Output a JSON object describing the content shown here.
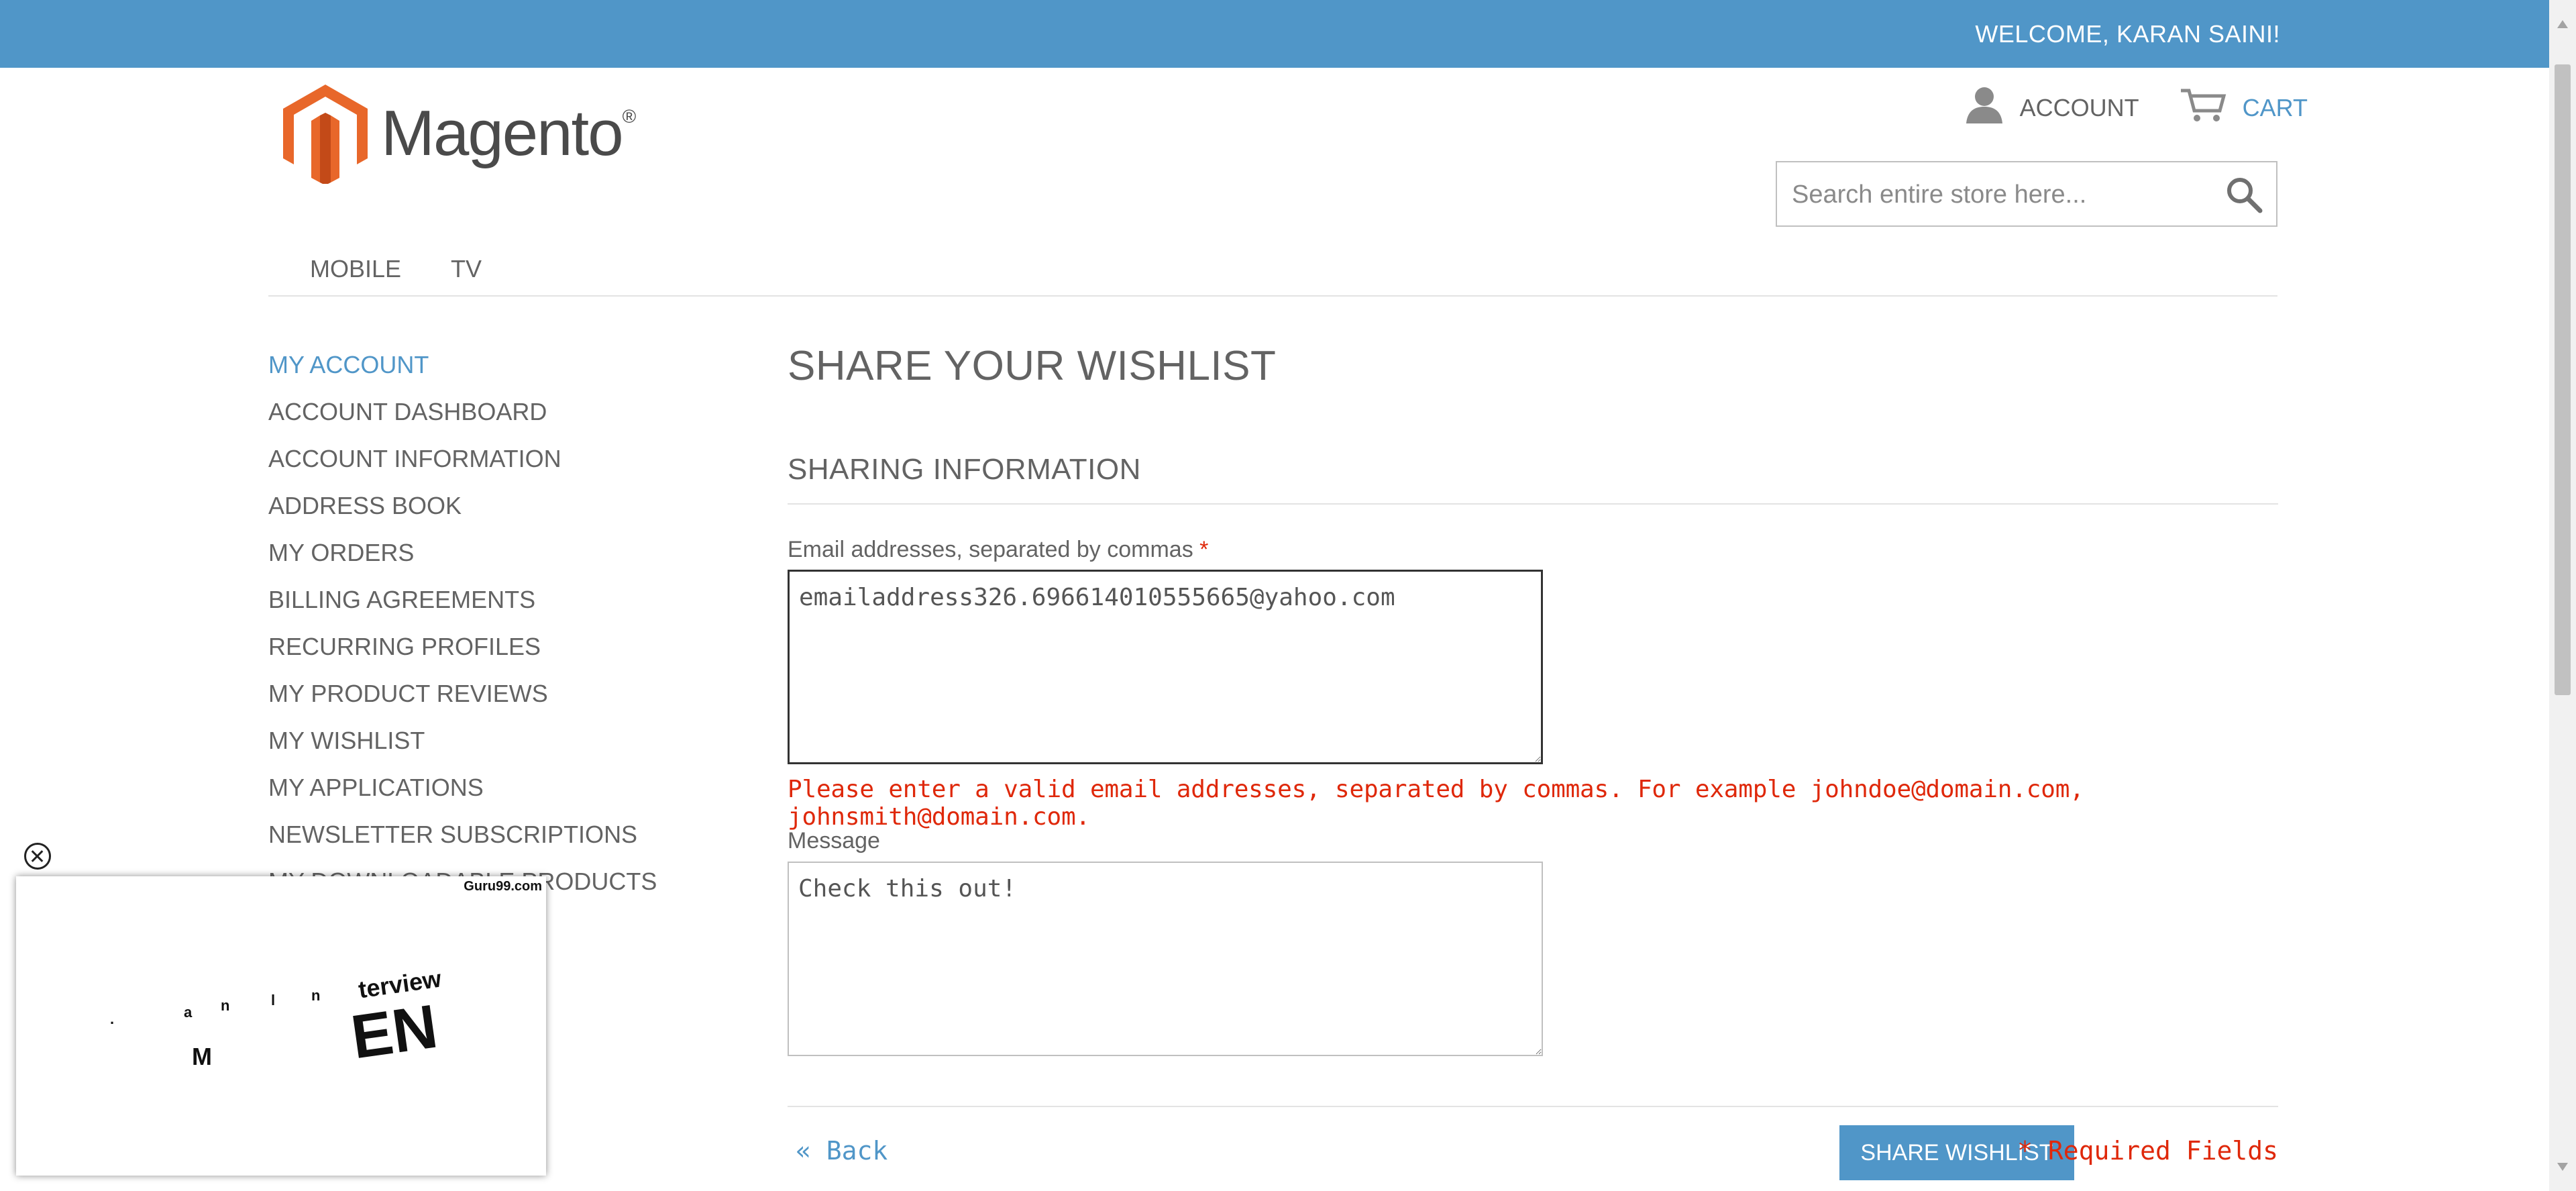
{
  "topbar": {
    "welcome": "WELCOME, KARAN SAINI!"
  },
  "logo": {
    "text": "Magento",
    "reg": "®"
  },
  "header": {
    "account_label": "ACCOUNT",
    "cart_label": "CART",
    "search_placeholder": "Search entire store here..."
  },
  "nav": {
    "items": [
      "MOBILE",
      "TV"
    ]
  },
  "sidebar": {
    "title": "MY ACCOUNT",
    "items": [
      "ACCOUNT DASHBOARD",
      "ACCOUNT INFORMATION",
      "ADDRESS BOOK",
      "MY ORDERS",
      "BILLING AGREEMENTS",
      "RECURRING PROFILES",
      "MY PRODUCT REVIEWS",
      "MY WISHLIST",
      "MY APPLICATIONS",
      "NEWSLETTER SUBSCRIPTIONS",
      "MY DOWNLOADABLE PRODUCTS"
    ]
  },
  "main": {
    "page_title": "SHARE YOUR WISHLIST",
    "section_title": "SHARING INFORMATION",
    "email_label": "Email addresses, separated by commas",
    "required_star": "*",
    "email_value": "emailaddress326.696614010555665@yahoo.com",
    "error_text": "Please enter a valid email addresses, separated by commas. For example johndoe@domain.com, johnsmith@domain.com.",
    "message_label": "Message",
    "message_value": "Check this out!",
    "back_label": "« Back",
    "share_button": "SHARE WISHLIST",
    "required_note": "* Required Fields"
  },
  "popup": {
    "brand": "Guru99.com",
    "word_top": "terview",
    "word_big": "EN",
    "word_m": "M",
    "fragments": [
      ".",
      "a",
      "n",
      "l",
      "n"
    ]
  },
  "colors": {
    "accent": "#5096c8",
    "error": "#df280a",
    "text": "#636363",
    "logo_orange": "#e8672a"
  }
}
